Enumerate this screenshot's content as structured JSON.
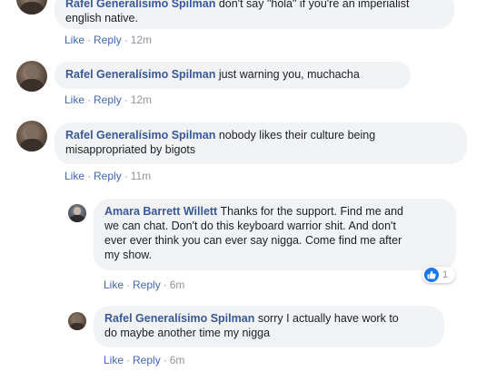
{
  "comments": [
    {
      "author": "Rafel Generalísimo Spilman",
      "text_line1": "don't say \"hola\" if you're an imperialist",
      "text_line2": "english native.",
      "like": "Like",
      "reply": "Reply",
      "time": "12m"
    },
    {
      "author": "Rafel Generalísimo Spilman",
      "text_line1": "just warning you, muchacha",
      "like": "Like",
      "reply": "Reply",
      "time": "12m"
    },
    {
      "author": "Rafel Generalísimo Spilman",
      "text_line1": "nobody likes their culture being",
      "text_line2": "misappropriated by bigots",
      "like": "Like",
      "reply": "Reply",
      "time": "11m"
    }
  ],
  "replies": [
    {
      "author": "Amara Barrett Willett",
      "text_line1": "Thanks for the support. Find me and",
      "text_line2": "we can chat. Don't do this keyboard warrior shit. And don't",
      "text_line3": "ever ever think you can ever say nigga. Come find me after",
      "text_line4": "my show.",
      "like": "Like",
      "reply": "Reply",
      "time": "6m",
      "reaction_count": "1",
      "reaction_icon": "thumbs-up-icon"
    },
    {
      "author": "Rafel Generalísimo Spilman",
      "text_line1": "sorry I actually have work to",
      "text_line2": "do maybe another time my nigga",
      "like": "Like",
      "reply": "Reply",
      "time": "6m"
    }
  ],
  "colors": {
    "author": "#385898",
    "link": "#4267b2",
    "meta": "#90949c",
    "bubble": "#f2f3f5",
    "like_badge": "#1877f2"
  }
}
